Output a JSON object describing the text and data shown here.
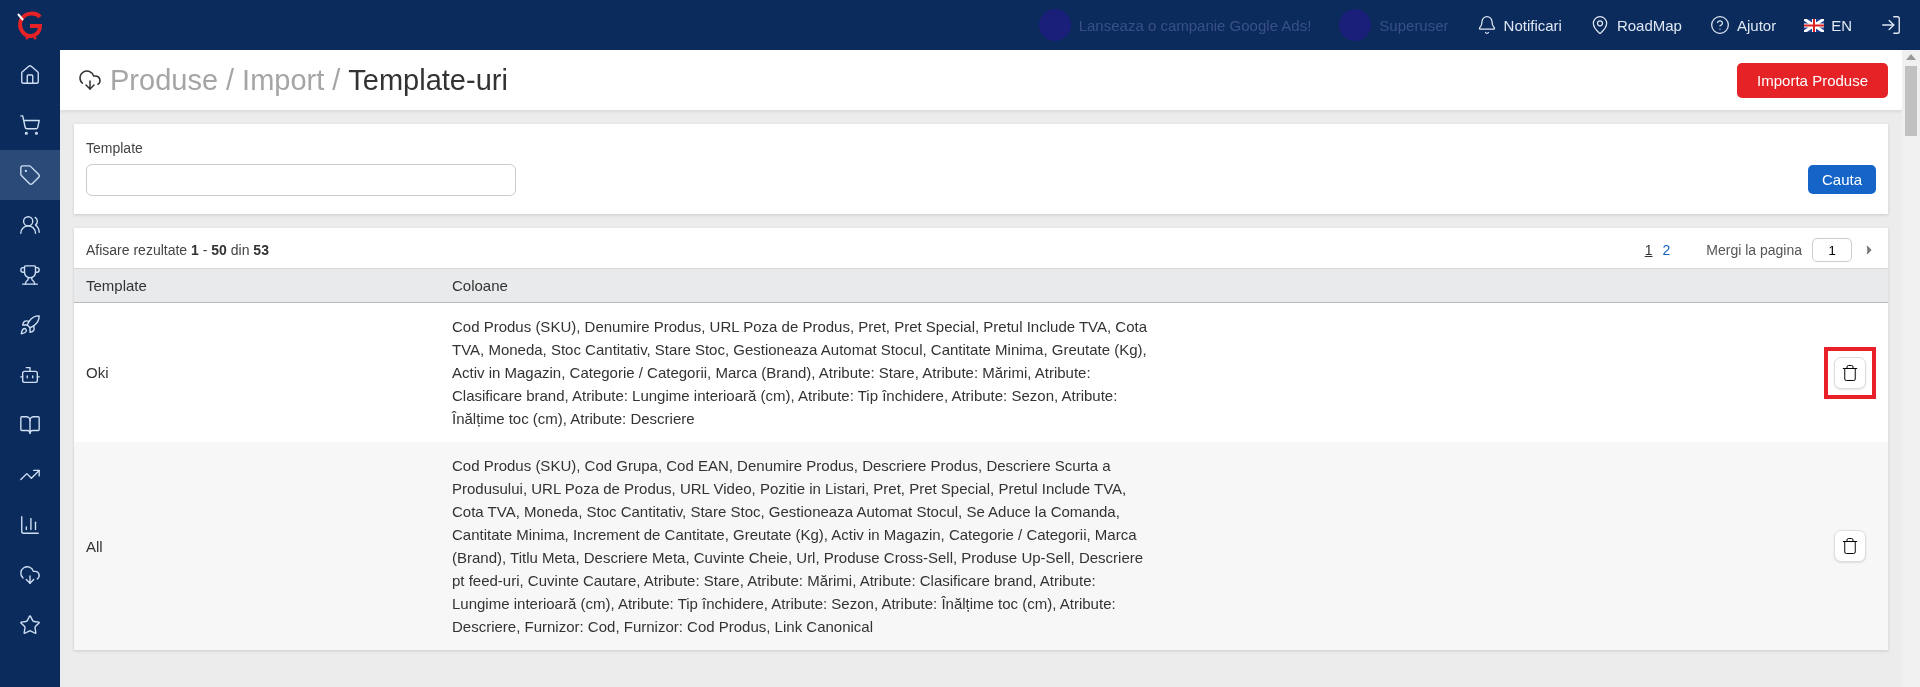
{
  "topbar": {
    "promo": "Lanseaza o campanie Google Ads!",
    "user": "Superuser",
    "links": [
      {
        "kind": "bell",
        "label": "Notificari"
      },
      {
        "kind": "pin",
        "label": "RoadMap"
      },
      {
        "kind": "help",
        "label": "Ajutor"
      },
      {
        "kind": "flag",
        "label": "EN"
      }
    ]
  },
  "sidebar": {
    "items": [
      {
        "kind": "home",
        "selected": false
      },
      {
        "kind": "cart",
        "selected": false
      },
      {
        "kind": "tag",
        "selected": true
      },
      {
        "kind": "users",
        "selected": false
      },
      {
        "kind": "trophy",
        "selected": false
      },
      {
        "kind": "rocket",
        "selected": false
      },
      {
        "kind": "robot",
        "selected": false
      },
      {
        "kind": "book",
        "selected": false
      },
      {
        "kind": "trend",
        "selected": false
      },
      {
        "kind": "bars",
        "selected": false
      },
      {
        "kind": "cloud",
        "selected": false
      },
      {
        "kind": "star",
        "selected": false
      }
    ]
  },
  "header": {
    "breadcrumb": [
      {
        "kind": "link",
        "text": "Produse"
      },
      {
        "kind": "separator",
        "text": "/"
      },
      {
        "kind": "link",
        "text": "Import"
      },
      {
        "kind": "separator",
        "text": "/"
      },
      {
        "kind": "current",
        "text": "Template-uri"
      }
    ],
    "action": "Importa Produse"
  },
  "filter": {
    "label": "Template",
    "button": "Cauta"
  },
  "results": {
    "summary": "Afisare rezultate **1** - **50** din **53**",
    "pages": [
      {
        "label": "1",
        "selected": true
      },
      {
        "label": "2",
        "selected": false
      }
    ],
    "goto_label": "Mergi la pagina",
    "goto_value": "1"
  },
  "table": {
    "columns": [
      "Template",
      "Coloane"
    ],
    "rows": [
      {
        "template": "Oki",
        "columns": "Cod Produs (SKU), Denumire Produs, URL Poza de Produs, Pret, Pret Special, Pretul Include TVA, Cota TVA, Moneda, Stoc Cantitativ, Stare Stoc, Gestioneaza Automat Stocul, Cantitate Minima, Greutate (Kg), Activ in Magazin, Categorie / Categorii, Marca (Brand), Atribute: Stare, Atribute: Mărimi, Atribute: Clasificare brand, Atribute: Lungime interioară (cm), Atribute: Tip închidere, Atribute: Sezon, Atribute: Înălțime toc (cm), Atribute: Descriere",
        "highlighted": true
      },
      {
        "template": "All",
        "columns": "Cod Produs (SKU), Cod Grupa, Cod EAN, Denumire Produs, Descriere Produs, Descriere Scurta a Produsului, URL Poza de Produs, URL Video, Pozitie in Listari, Pret, Pret Special, Pretul Include TVA, Cota TVA, Moneda, Stoc Cantitativ, Stare Stoc, Gestioneaza Automat Stocul, Se Aduce la Comanda, Cantitate Minima, Increment de Cantitate, Greutate (Kg), Activ in Magazin, Categorie / Categorii, Marca (Brand), Titlu Meta, Descriere Meta, Cuvinte Cheie, Url, Produse Cross-Sell, Produse Up-Sell, Descriere pt feed-uri, Cuvinte Cautare, Atribute: Stare, Atribute: Mărimi, Atribute: Clasificare brand, Atribute: Lungime interioară (cm), Atribute: Tip închidere, Atribute: Sezon, Atribute: Înălțime toc (cm), Atribute: Descriere, Furnizor: Cod, Furnizor: Cod Produs, Link Canonical",
        "highlighted": false
      }
    ]
  }
}
